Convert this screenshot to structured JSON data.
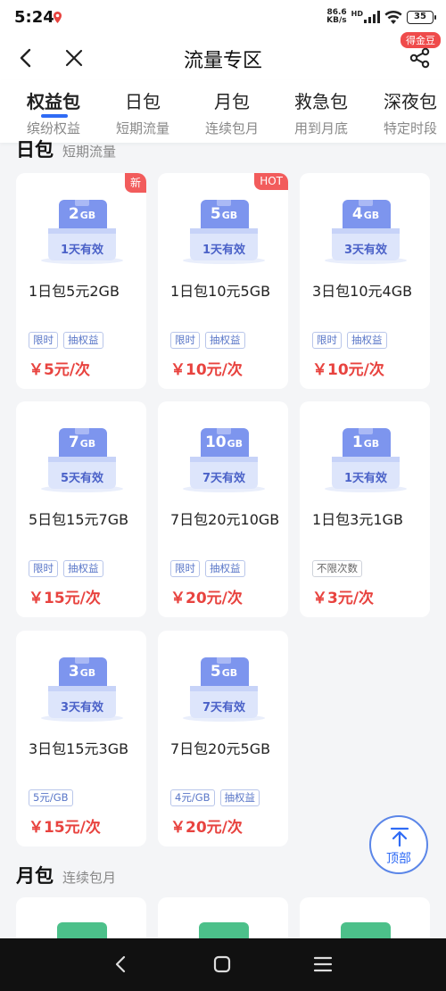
{
  "status_bar": {
    "time": "5:24",
    "speed_value": "86.6",
    "speed_unit": "KB/s",
    "network": "HD",
    "battery": "35"
  },
  "header": {
    "title": "流量专区",
    "coin_badge": "得金豆"
  },
  "tabs": [
    {
      "label": "权益包",
      "sub": "缤纷权益"
    },
    {
      "label": "日包",
      "sub": "短期流量"
    },
    {
      "label": "月包",
      "sub": "连续包月"
    },
    {
      "label": "救急包",
      "sub": "用到月底"
    },
    {
      "label": "深夜包",
      "sub": "特定时段"
    }
  ],
  "sections": {
    "daily": {
      "title": "日包",
      "sub": "短期流量"
    },
    "monthly": {
      "title": "月包",
      "sub": "连续包月"
    }
  },
  "cards": [
    {
      "size": "2",
      "unit": "GB",
      "valid": "1天有效",
      "name": "1日包5元2GB",
      "tags": [
        "限时",
        "抽权益"
      ],
      "price": "￥5元/次",
      "corner": "新"
    },
    {
      "size": "5",
      "unit": "GB",
      "valid": "1天有效",
      "name": "1日包10元5GB",
      "tags": [
        "限时",
        "抽权益"
      ],
      "price": "￥10元/次",
      "corner": "HOT"
    },
    {
      "size": "4",
      "unit": "GB",
      "valid": "3天有效",
      "name": "3日包10元4GB",
      "tags": [
        "限时",
        "抽权益"
      ],
      "price": "￥10元/次",
      "corner": ""
    },
    {
      "size": "7",
      "unit": "GB",
      "valid": "5天有效",
      "name": "5日包15元7GB",
      "tags": [
        "限时",
        "抽权益"
      ],
      "price": "￥15元/次",
      "corner": ""
    },
    {
      "size": "10",
      "unit": "GB",
      "valid": "7天有效",
      "name": "7日包20元10GB",
      "tags": [
        "限时",
        "抽权益"
      ],
      "price": "￥20元/次",
      "corner": ""
    },
    {
      "size": "1",
      "unit": "GB",
      "valid": "1天有效",
      "name": "1日包3元1GB",
      "tags": [
        "不限次数"
      ],
      "price": "￥3元/次",
      "corner": ""
    },
    {
      "size": "3",
      "unit": "GB",
      "valid": "3天有效",
      "name": "3日包15元3GB",
      "tags": [
        "5元/GB"
      ],
      "price": "￥15元/次",
      "corner": ""
    },
    {
      "size": "5",
      "unit": "GB",
      "valid": "7天有效",
      "name": "7日包20元5GB",
      "tags": [
        "4元/GB",
        "抽权益"
      ],
      "price": "￥20元/次",
      "corner": ""
    }
  ],
  "top_button": {
    "label": "顶部"
  },
  "colors": {
    "accent": "#2f6bf5",
    "price": "#e8433f",
    "badge": "#f25c5c",
    "monthly": "#4cc08a"
  },
  "icons": [
    "location-icon",
    "signal-icon",
    "wifi-icon",
    "battery-icon",
    "back-icon",
    "close-icon",
    "share-icon",
    "arrow-up-icon",
    "nav-back-icon",
    "nav-home-icon",
    "nav-menu-icon"
  ]
}
